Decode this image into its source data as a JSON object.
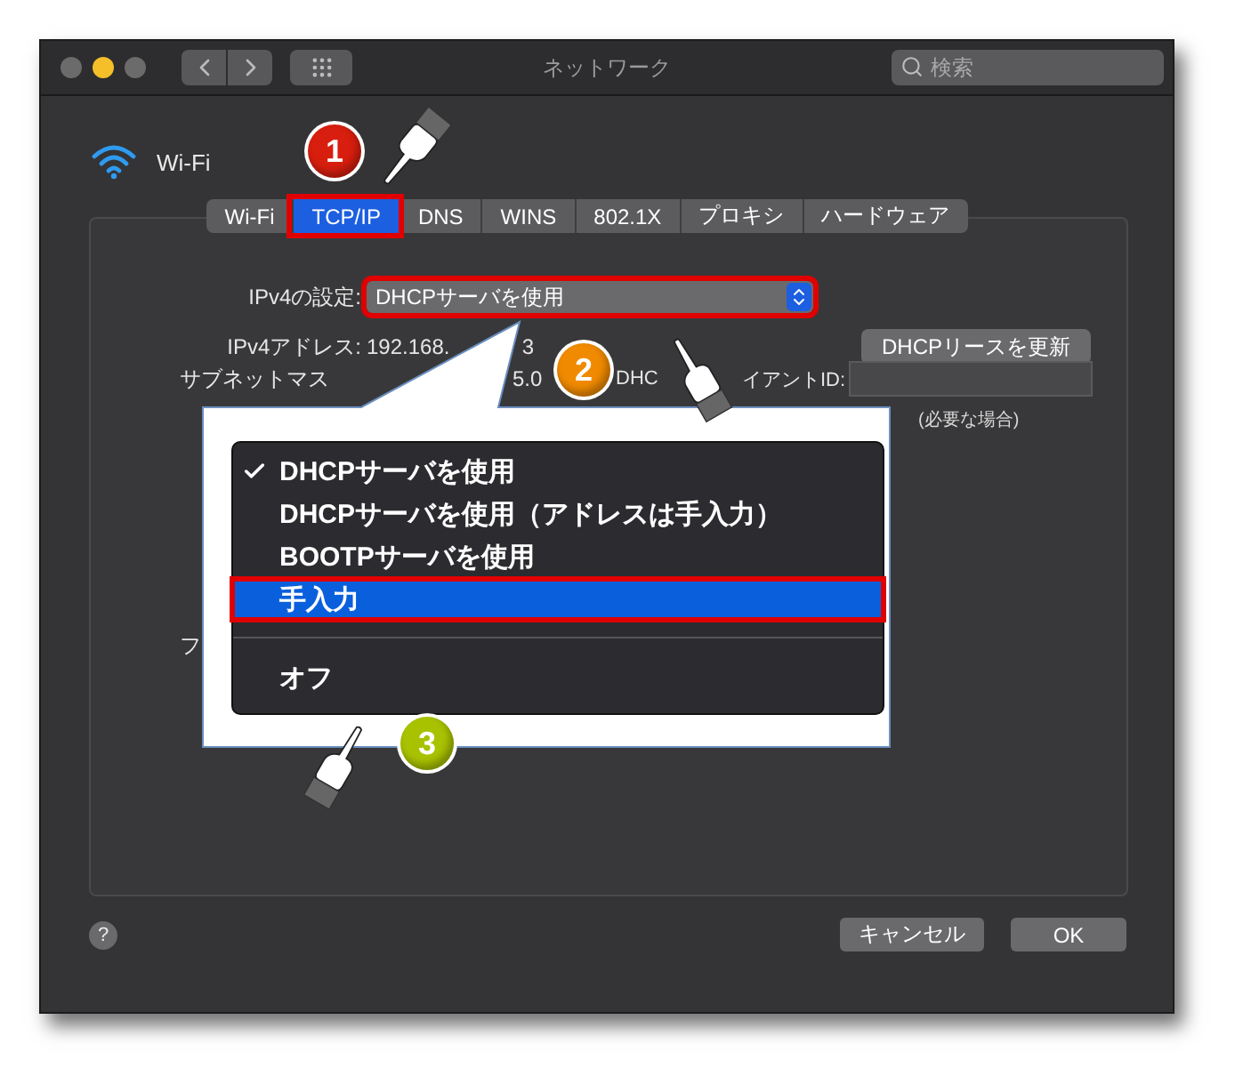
{
  "window": {
    "title": "ネットワーク",
    "search_placeholder": "検索"
  },
  "interface": {
    "name": "Wi-Fi"
  },
  "tabs": [
    {
      "label": "Wi-Fi",
      "selected": false,
      "highlighted": false
    },
    {
      "label": "TCP/IP",
      "selected": true,
      "highlighted": true
    },
    {
      "label": "DNS",
      "selected": false,
      "highlighted": false
    },
    {
      "label": "WINS",
      "selected": false,
      "highlighted": false
    },
    {
      "label": "802.1X",
      "selected": false,
      "highlighted": false
    },
    {
      "label": "プロキシ",
      "selected": false,
      "highlighted": false
    },
    {
      "label": "ハードウェア",
      "selected": false,
      "highlighted": false
    }
  ],
  "settings": {
    "ipv4_config_label": "IPv4の設定:",
    "ipv4_config_value": "DHCPサーバを使用",
    "ipv4_config_highlighted": true,
    "ipv4_address_label": "IPv4アドレス:",
    "ipv4_address_value": "192.168.",
    "ipv4_address_value_tail": "3",
    "renew_button": "DHCPリースを更新",
    "subnet_label": "サブネットマス",
    "subnet_value": "5.0",
    "client_id_label_head": "DHC",
    "client_id_label_tail": "イアントID:",
    "client_id_hint": "(必要な場合)",
    "hidden_row_label": "フ"
  },
  "popup_menu": {
    "items": [
      {
        "kind": "option",
        "label": "DHCPサーバを使用",
        "checked": true,
        "selected": false,
        "highlighted": false
      },
      {
        "kind": "option",
        "label": "DHCPサーバを使用（アドレスは手入力）",
        "checked": false,
        "selected": false,
        "highlighted": false
      },
      {
        "kind": "option",
        "label": "BOOTPサーバを使用",
        "checked": false,
        "selected": false,
        "highlighted": false
      },
      {
        "kind": "option",
        "label": "手入力",
        "checked": false,
        "selected": true,
        "highlighted": true
      },
      {
        "kind": "separator"
      },
      {
        "kind": "option",
        "label": "オフ",
        "checked": false,
        "selected": false,
        "highlighted": false
      }
    ]
  },
  "help_label": "?",
  "buttons": [
    {
      "label": "キャンセル"
    },
    {
      "label": "OK"
    }
  ],
  "badges": [
    {
      "label": "1",
      "color": "#d81e0e"
    },
    {
      "label": "2",
      "color": "#f08a00"
    },
    {
      "label": "3",
      "color": "#a9c200"
    }
  ]
}
